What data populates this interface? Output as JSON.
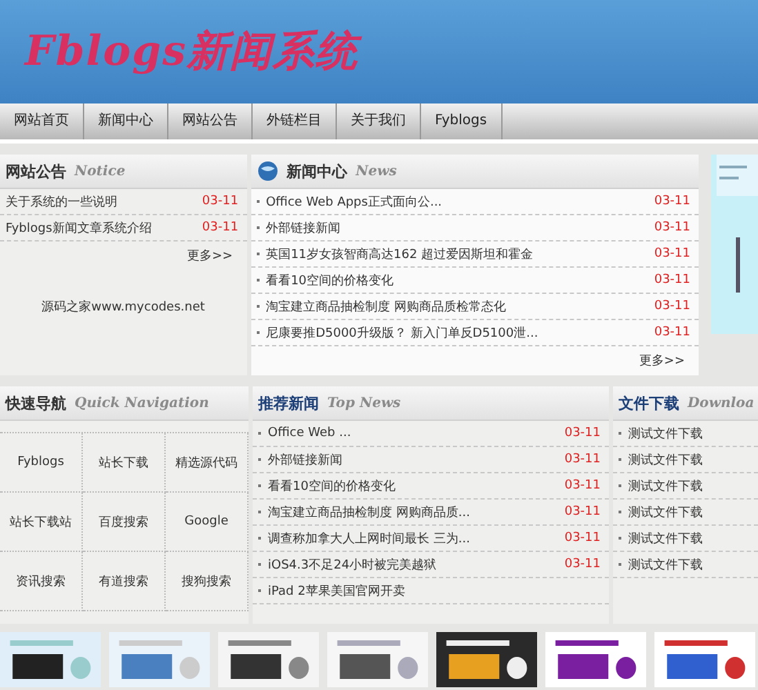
{
  "header": {
    "logo": "Fblogs新闻系统"
  },
  "nav": [
    "网站首页",
    "新闻中心",
    "网站公告",
    "外链栏目",
    "关于我们",
    "Fyblogs"
  ],
  "notice": {
    "title": "网站公告",
    "subtitle": "Notice",
    "items": [
      {
        "title": "关于系统的一些说明",
        "date": "03-11"
      },
      {
        "title": "Fyblogs新闻文章系统介绍",
        "date": "03-11"
      }
    ],
    "more": "更多>>",
    "footer_text": "源码之家www.mycodes.net"
  },
  "news": {
    "title": "新闻中心",
    "subtitle": "News",
    "items": [
      {
        "title": "Office Web Apps正式面向公...",
        "date": "03-11"
      },
      {
        "title": "外部链接新闻",
        "date": "03-11"
      },
      {
        "title": "英国11岁女孩智商高达162 超过爱因斯坦和霍金",
        "date": "03-11"
      },
      {
        "title": "看看10空间的价格变化",
        "date": "03-11"
      },
      {
        "title": "淘宝建立商品抽检制度 网购商品质检常态化",
        "date": "03-11"
      },
      {
        "title": "尼康要推D5000升级版？ 新入门单反D5100泄...",
        "date": "03-11"
      }
    ],
    "more": "更多>>"
  },
  "quick_nav": {
    "title": "快速导航",
    "subtitle": "Quick Navigation",
    "links": [
      "Fyblogs",
      "站长下载",
      "精选源代码",
      "站长下载站",
      "百度搜索",
      "Google",
      "资讯搜索",
      "有道搜索",
      "搜狗搜索"
    ]
  },
  "top_news": {
    "title": "推荐新闻",
    "subtitle": "Top News",
    "items": [
      {
        "title": "Office Web ...",
        "date": "03-11"
      },
      {
        "title": "外部链接新闻",
        "date": "03-11"
      },
      {
        "title": "看看10空间的价格变化",
        "date": "03-11"
      },
      {
        "title": "淘宝建立商品抽检制度 网购商品质...",
        "date": "03-11"
      },
      {
        "title": "调查称加拿大人上网时间最长 三为...",
        "date": "03-11"
      },
      {
        "title": "iOS4.3不足24小时被完美越狱",
        "date": "03-11"
      },
      {
        "title": "iPad 2苹果美国官网开卖"
      }
    ]
  },
  "downloads": {
    "title": "文件下载",
    "subtitle": "Downloa",
    "items": [
      "测试文件下载",
      "测试文件下载",
      "测试文件下载",
      "测试文件下载",
      "测试文件下载",
      "测试文件下载"
    ]
  }
}
